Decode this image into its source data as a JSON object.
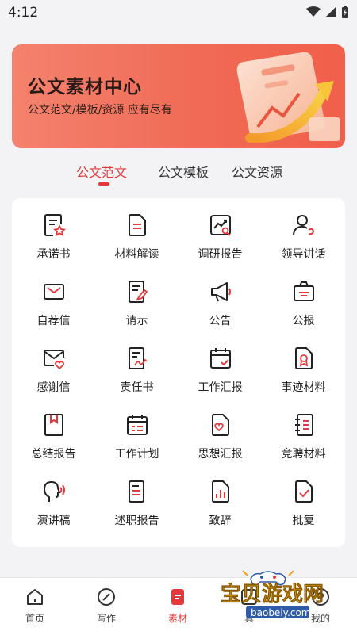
{
  "status_bar": {
    "time": "4:12"
  },
  "banner": {
    "title": "公文素材中心",
    "subtitle": "公文范文/模板/资源 应有尽有"
  },
  "tabs": [
    {
      "label": "公文范文",
      "active": true
    },
    {
      "label": "公文模板",
      "active": false
    },
    {
      "label": "公文资源",
      "active": false
    }
  ],
  "grid": [
    {
      "label": "承诺书",
      "icon": "doc-star-icon"
    },
    {
      "label": "材料解读",
      "icon": "doc-lines-icon"
    },
    {
      "label": "调研报告",
      "icon": "chart-search-icon"
    },
    {
      "label": "领导讲话",
      "icon": "person-speech-icon"
    },
    {
      "label": "自荐信",
      "icon": "envelope-icon"
    },
    {
      "label": "请示",
      "icon": "doc-pen-icon"
    },
    {
      "label": "公告",
      "icon": "megaphone-icon"
    },
    {
      "label": "公报",
      "icon": "bag-icon"
    },
    {
      "label": "感谢信",
      "icon": "heart-envelope-icon"
    },
    {
      "label": "责任书",
      "icon": "doc-sign-icon"
    },
    {
      "label": "工作汇报",
      "icon": "calendar-check-icon"
    },
    {
      "label": "事迹材料",
      "icon": "doc-award-icon"
    },
    {
      "label": "总结报告",
      "icon": "bookmark-book-icon"
    },
    {
      "label": "工作计划",
      "icon": "calendar-icon"
    },
    {
      "label": "思想汇报",
      "icon": "heart-doc-icon"
    },
    {
      "label": "竞聘材料",
      "icon": "notebook-icon"
    },
    {
      "label": "演讲稿",
      "icon": "voice-head-icon"
    },
    {
      "label": "述职报告",
      "icon": "doc-report-icon"
    },
    {
      "label": "致辞",
      "icon": "doc-chart-icon"
    },
    {
      "label": "批复",
      "icon": "doc-check-icon"
    }
  ],
  "bottom_nav": [
    {
      "label": "首页",
      "icon": "home-icon",
      "active": false
    },
    {
      "label": "写作",
      "icon": "compass-icon",
      "active": false
    },
    {
      "label": "素材",
      "icon": "material-icon",
      "active": true
    },
    {
      "label": "具",
      "icon": "tools-icon",
      "active": false
    },
    {
      "label": "我的",
      "icon": "profile-icon",
      "active": false
    }
  ],
  "watermark": {
    "text": "宝贝游戏网",
    "url_text": "baobeiy.com"
  },
  "colors": {
    "accent": "#e4393c",
    "banner": "#f06b56",
    "background": "#f3f3f5"
  }
}
